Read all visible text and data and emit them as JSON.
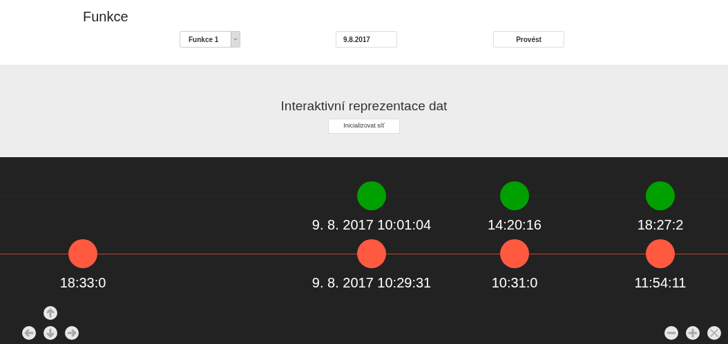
{
  "title": "Funkce",
  "controls": {
    "function_select": {
      "value": "Funkce 1"
    },
    "date_field": {
      "value": "9.8.2017"
    },
    "run_button": "Provést"
  },
  "panel": {
    "title": "Interaktivní reprezentace dat",
    "init_button": "Inicializovat síť"
  },
  "network": {
    "lanes": [
      {
        "color": "#00a000",
        "nodes": [
          {
            "label": "9. 8. 2017 10:01:04"
          },
          {
            "label": "14:20:16"
          },
          {
            "label": "18:27:2"
          }
        ]
      },
      {
        "color": "#ff5a40",
        "nodes": [
          {
            "label": "18:33:0"
          },
          {
            "label": "9. 8. 2017 10:29:31"
          },
          {
            "label": "10:31:0"
          },
          {
            "label": "11:54:11"
          }
        ]
      }
    ]
  }
}
